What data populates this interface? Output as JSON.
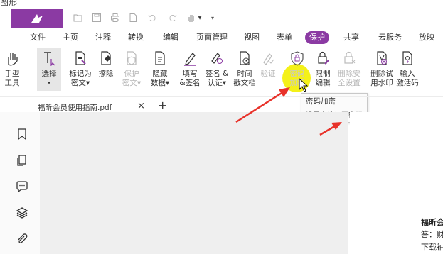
{
  "header": {
    "cut_title": "图形"
  },
  "menu": [
    {
      "label": "文件",
      "active": false
    },
    {
      "label": "主页",
      "active": false
    },
    {
      "label": "注释",
      "active": false
    },
    {
      "label": "转换",
      "active": false
    },
    {
      "label": "编辑",
      "active": false
    },
    {
      "label": "页面管理",
      "active": false
    },
    {
      "label": "视图",
      "active": false
    },
    {
      "label": "表单",
      "active": false
    },
    {
      "label": "保护",
      "active": true
    },
    {
      "label": "共享",
      "active": false
    },
    {
      "label": "云服务",
      "active": false
    },
    {
      "label": "放映",
      "active": false
    }
  ],
  "tools": [
    {
      "line1": "手型",
      "line2": "工具",
      "icon": "hand-icon",
      "disabled": false
    },
    {
      "line1": "选择",
      "line2": "▾",
      "icon": "select-cursor-icon",
      "disabled": false
    },
    {
      "line1": "标记为",
      "line2": "密文▾",
      "icon": "mark-redaction-icon",
      "disabled": false
    },
    {
      "line1": "擦除",
      "line2": "",
      "icon": "erase-icon",
      "disabled": false
    },
    {
      "line1": "保护",
      "line2": "密文▾",
      "icon": "protect-redaction-icon",
      "disabled": true
    },
    {
      "line1": "隐藏",
      "line2": "数据▾",
      "icon": "hide-data-icon",
      "disabled": false
    },
    {
      "line1": "填写",
      "line2": "&签名",
      "icon": "fill-sign-icon",
      "disabled": false
    },
    {
      "line1": "签名 &",
      "line2": "认证▾",
      "icon": "sign-certify-icon",
      "disabled": false
    },
    {
      "line1": "时间",
      "line2": "戳文档",
      "icon": "timestamp-icon",
      "disabled": false
    },
    {
      "line1": "验证",
      "line2": "",
      "icon": "verify-icon",
      "disabled": true
    },
    {
      "line1": "密码",
      "line2": "加密",
      "icon": "password-shield-icon",
      "disabled": false
    },
    {
      "line1": "限制",
      "line2": "编辑",
      "icon": "restrict-edit-icon",
      "disabled": false
    },
    {
      "line1": "删除安",
      "line2": "全设置",
      "icon": "remove-security-icon",
      "disabled": true
    },
    {
      "line1": "删除试",
      "line2": "用水印",
      "icon": "remove-watermark-icon",
      "disabled": false
    },
    {
      "line1": "输入",
      "line2": "激活码",
      "icon": "activation-code-icon",
      "disabled": false
    }
  ],
  "tooltip": {
    "title": "密码加密",
    "description": "设置文档打开密码"
  },
  "document_tab": {
    "name": "福昕会员使用指南.pdf",
    "close": "×",
    "add": "+"
  },
  "page_text": {
    "line1": "福昕会",
    "line2": "答：财",
    "line3": "下载袖"
  },
  "colors": {
    "brand": "#8b3aa3",
    "highlight": "#f3f000",
    "arrow": "#e8322a"
  }
}
